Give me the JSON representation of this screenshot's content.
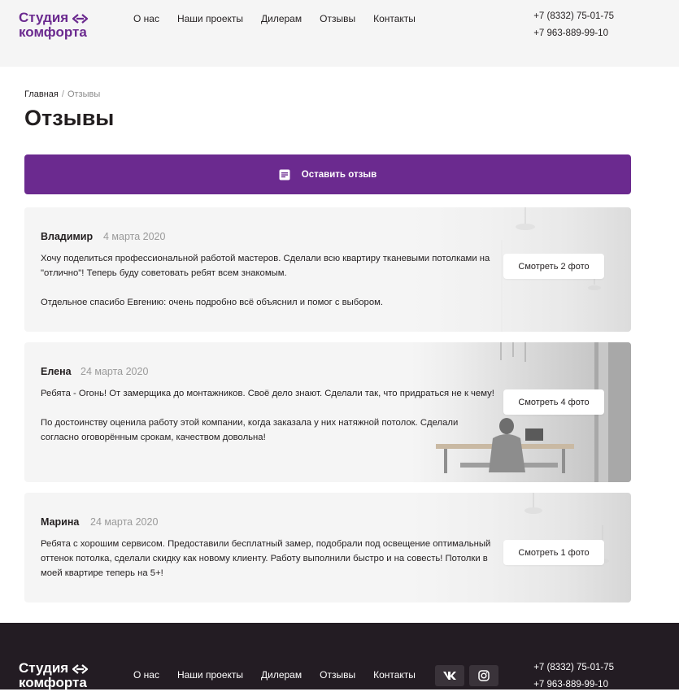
{
  "logo": {
    "line1": "Студия",
    "line2": "комфорта",
    "color": "#6b2a8f"
  },
  "nav": [
    "О нас",
    "Наши проекты",
    "Дилерам",
    "Отзывы",
    "Контакты"
  ],
  "phones": [
    "+7 (8332) 75-01-75",
    "+7 963-889-99-10"
  ],
  "breadcrumb": {
    "home": "Главная",
    "separator": "/",
    "current": "Отзывы"
  },
  "page_title": "Отзывы",
  "leave_review": {
    "label": "Оставить отзыв",
    "icon": "message-square-icon"
  },
  "reviews": [
    {
      "author": "Владимир",
      "date": "4 марта 2020",
      "paragraphs": [
        "Хочу поделиться профессиональной работой мастеров. Сделали всю квартиру тканевыми потолками на \"отлично\"! Теперь буду советовать ребят всем знакомым.",
        "Отдельное спасибо Евгению: очень подробно всё объяснил и помог с выбором."
      ],
      "photos_label": "Смотреть 2 фото"
    },
    {
      "author": "Елена",
      "date": "24 марта 2020",
      "paragraphs": [
        "Ребята - Огонь! От замерщика до монтажников. Своё дело знают. Сделали так, что придраться не к чему!",
        "По достоинству оценила работу этой компании, когда заказала у них натяжной потолок. Сделали согласно оговорённым срокам, качеством довольна!"
      ],
      "photos_label": "Смотреть 4 фото"
    },
    {
      "author": "Марина",
      "date": "24 марта 2020",
      "paragraphs": [
        "Ребята с хорошим сервисом. Предоставили бесплатный замер, подобрали под освещение оптимальный оттенок потолка, сделали скидку как новому клиенту. Работу выполнили быстро и на совесть! Потолки в моей квартире теперь на 5+!"
      ],
      "photos_label": "Смотреть 1 фото"
    }
  ],
  "footer": {
    "nav": [
      "О нас",
      "Наши проекты",
      "Дилерам",
      "Отзывы",
      "Контакты"
    ],
    "social": [
      "vk-icon",
      "instagram-icon"
    ],
    "phones": [
      "+7 (8332) 75-01-75",
      "+7 963-889-99-10"
    ]
  },
  "colors": {
    "accent": "#6b2a8f",
    "footer_bg": "#231c23",
    "card_bg": "#f5f5f5"
  }
}
